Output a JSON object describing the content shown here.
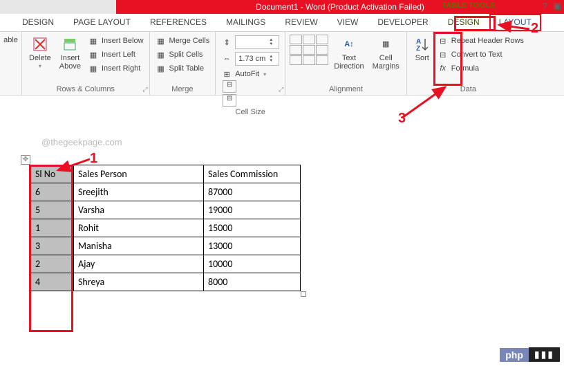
{
  "title": "Document1 -  Word (Product Activation Failed)",
  "tools_label": "TABLE TOOLS",
  "tabs": [
    "DESIGN",
    "PAGE LAYOUT",
    "REFERENCES",
    "MAILINGS",
    "REVIEW",
    "VIEW",
    "DEVELOPER",
    "DESIGN",
    "LAYOUT"
  ],
  "active_tab_index": 8,
  "ribbon": {
    "table_group": {
      "draw": "able",
      "label": ""
    },
    "rows_cols": {
      "delete": "Delete",
      "insert_above": "Insert\nAbove",
      "insert_below": "Insert Below",
      "insert_left": "Insert Left",
      "insert_right": "Insert Right",
      "label": "Rows & Columns"
    },
    "merge": {
      "merge": "Merge Cells",
      "split": "Split Cells",
      "split_table": "Split Table",
      "label": "Merge"
    },
    "cell_size": {
      "height": "",
      "width": "1.73 cm",
      "autofit": "AutoFit",
      "label": "Cell Size"
    },
    "alignment": {
      "text_direction": "Text\nDirection",
      "cell_margins": "Cell\nMargins",
      "label": "Alignment"
    },
    "data": {
      "sort": "Sort",
      "repeat": "Repeat Header Rows",
      "convert": "Convert to Text",
      "formula": "Formula",
      "label": "Data"
    }
  },
  "watermark": "@thegeekpage.com",
  "table": {
    "headers": [
      "Sl No",
      "Sales Person",
      "Sales Commission"
    ],
    "rows": [
      [
        "6",
        "Sreejith",
        "87000"
      ],
      [
        "5",
        "Varsha",
        "19000"
      ],
      [
        "1",
        "Rohit",
        "15000"
      ],
      [
        "3",
        "Manisha",
        "13000"
      ],
      [
        "2",
        "Ajay",
        "10000"
      ],
      [
        "4",
        "Shreya",
        "8000"
      ]
    ]
  },
  "annotations": {
    "n1": "1",
    "n2": "2",
    "n3": "3"
  },
  "badge": {
    "p": "php",
    "c": "▮▮▮"
  }
}
